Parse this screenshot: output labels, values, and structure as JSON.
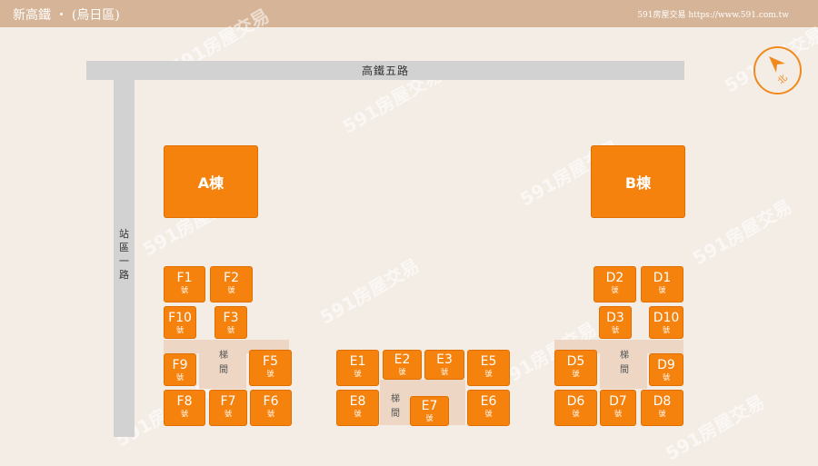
{
  "header": {
    "title": "新高鐵 ‧ (烏日區)",
    "site": "591房屋交易 https://www.591.com.tw"
  },
  "roads": {
    "top": "高鐵五路",
    "side_chars": [
      "站",
      "區",
      "一",
      "路"
    ]
  },
  "compass": {
    "label": "北"
  },
  "buildings": {
    "a": "A棟",
    "b": "B棟"
  },
  "unit_suffix": "號",
  "stair_chars": [
    "梯",
    "間"
  ],
  "units": {
    "F1": "F1",
    "F2": "F2",
    "F3": "F3",
    "F5": "F5",
    "F6": "F6",
    "F7": "F7",
    "F8": "F8",
    "F9": "F9",
    "F10": "F10",
    "E1": "E1",
    "E2": "E2",
    "E3": "E3",
    "E5": "E5",
    "E6": "E6",
    "E7": "E7",
    "E8": "E8",
    "D1": "D1",
    "D2": "D2",
    "D3": "D3",
    "D5": "D5",
    "D6": "D6",
    "D7": "D7",
    "D8": "D8",
    "D9": "D9",
    "D10": "D10"
  },
  "watermark": "591房屋交易",
  "colors": {
    "unit": "#f5820d",
    "header": "#d6b497",
    "road": "#d2d2d2",
    "stair_core": "#edd7c4"
  }
}
